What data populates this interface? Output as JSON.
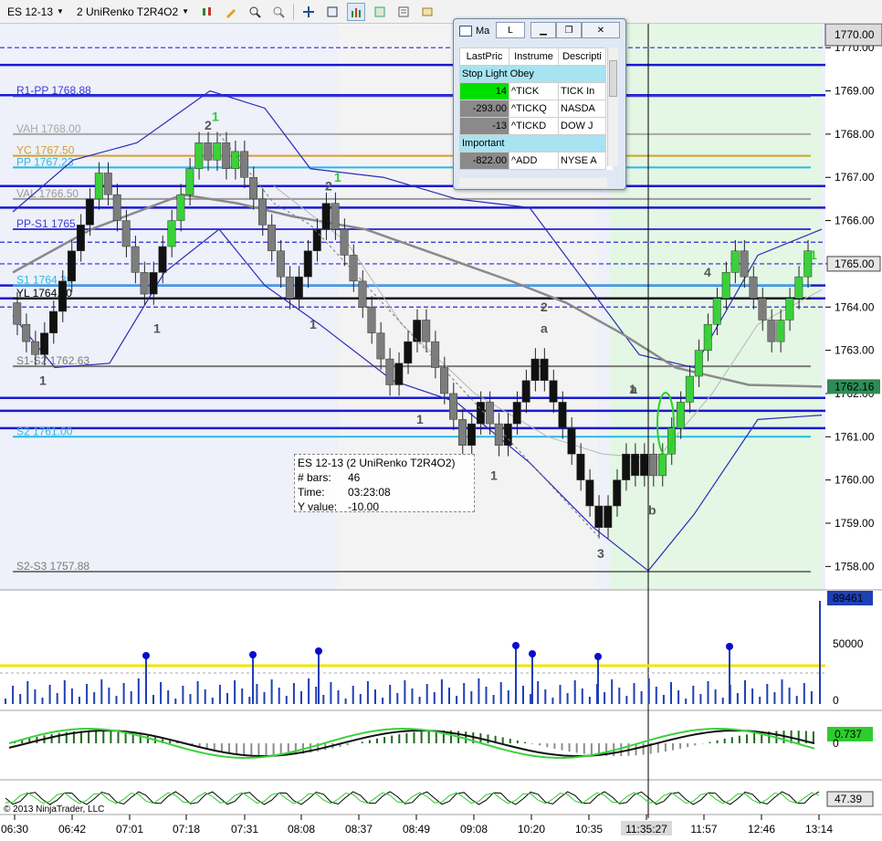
{
  "toolbar": {
    "instrument": "ES 12-13",
    "bar_type": "2 UniRenko T2R4O2"
  },
  "price_axis": {
    "ticks": [
      "1770.00",
      "1769.00",
      "1768.00",
      "1767.00",
      "1766.00",
      "1765.00",
      "1764.00",
      "1763.00",
      "1762.00",
      "1761.00",
      "1760.00",
      "1759.00",
      "1758.00"
    ],
    "current_price": "1765.00",
    "sma_value": "1762.16"
  },
  "levels": [
    {
      "label": "R1-PP 1768.88",
      "value": 1768.88,
      "color": "#3b3bd6"
    },
    {
      "label": "VAH 1768.00",
      "value": 1768.0,
      "color": "#a8a8a8"
    },
    {
      "label": "YC 1767.50",
      "value": 1767.5,
      "color": "#d4a02a"
    },
    {
      "label": "PP 1767.23",
      "value": 1767.23,
      "color": "#28b8e6"
    },
    {
      "label": "VAL 1766.50",
      "value": 1766.5,
      "color": "#9a9a9a"
    },
    {
      "label": "PP-S1 1765",
      "value": 1765.8,
      "color": "#3b3bd6"
    },
    {
      "label": "S1 1764.39",
      "value": 1764.5,
      "color": "#28b8e6"
    },
    {
      "label": "YL 1764.00",
      "value": 1764.2,
      "color": "#000000"
    },
    {
      "label": "S1-S2 1762.63",
      "value": 1762.63,
      "color": "#7a7a7a"
    },
    {
      "label": "S2 1761.00",
      "value": 1761.0,
      "color": "#28b8e6"
    },
    {
      "label": "S2-S3 1757.88",
      "value": 1757.88,
      "color": "#7a7a7a"
    }
  ],
  "wave_labels": [
    "2",
    "1",
    "1",
    "1",
    "2",
    "1",
    "1",
    "1",
    "1",
    "2",
    "a",
    "1",
    "a",
    "3",
    "b",
    "4",
    "1"
  ],
  "data_box": {
    "title": "ES 12-13 (2 UniRenko T2R4O2)",
    "bars_label": "# bars:",
    "bars_value": "46",
    "time_label": "Time:",
    "time_value": "03:23:08",
    "y_label": "Y value:",
    "y_value": "-10.00"
  },
  "market_analyzer": {
    "title": "Ma",
    "button_l": "L",
    "headers": [
      "LastPric",
      "Instrume",
      "Descripti"
    ],
    "section1": "Stop Light Obey",
    "rows1": [
      {
        "last": "14",
        "instrument": "^TICK",
        "desc": "TICK In"
      },
      {
        "last": "-293.00",
        "instrument": "^TICKQ",
        "desc": "NASDA"
      },
      {
        "last": "-13",
        "instrument": "^TICKD",
        "desc": "DOW J"
      }
    ],
    "section2": "Important",
    "rows2": [
      {
        "last": "-822.00",
        "instrument": "^ADD",
        "desc": "NYSE A"
      }
    ]
  },
  "volume_panel": {
    "max_label": "89461",
    "tick_50000": "50000",
    "tick_0": "0"
  },
  "macd_panel": {
    "value": "0.737",
    "tick_0": "0"
  },
  "osc_panel": {
    "value": "47.39"
  },
  "time_axis": {
    "ticks": [
      "06:30",
      "06:42",
      "07:01",
      "07:18",
      "07:31",
      "08:08",
      "08:37",
      "08:49",
      "09:08",
      "10:20",
      "10:35",
      "11:35:27",
      "11:57",
      "12:46",
      "13:14"
    ],
    "crosshair_time": "11:35:27"
  },
  "copyright": "© 2013 NinjaTrader, LLC",
  "chart_data": {
    "type": "candlestick-renko",
    "instrument": "ES 12-13",
    "y_range": [
      1757.5,
      1770.3
    ],
    "series": [
      {
        "name": "close",
        "values": [
          1763.6,
          1763.2,
          1762.9,
          1763.4,
          1763.9,
          1764.6,
          1765.3,
          1765.9,
          1766.5,
          1767.1,
          1766.6,
          1766.0,
          1765.4,
          1764.8,
          1764.3,
          1764.8,
          1765.4,
          1766.0,
          1766.6,
          1767.2,
          1767.8,
          1767.4,
          1767.8,
          1767.2,
          1767.6,
          1767.0,
          1766.5,
          1765.9,
          1765.3,
          1764.7,
          1764.2,
          1764.7,
          1765.3,
          1765.8,
          1766.4,
          1765.8,
          1765.2,
          1764.6,
          1764.0,
          1763.4,
          1762.8,
          1762.2,
          1762.7,
          1763.2,
          1763.7,
          1763.2,
          1762.6,
          1762.0,
          1761.4,
          1760.8,
          1761.3,
          1761.8,
          1761.3,
          1760.8,
          1761.3,
          1761.8,
          1762.3,
          1762.8,
          1762.3,
          1761.8,
          1761.2,
          1760.6,
          1760.0,
          1759.4,
          1758.9,
          1759.4,
          1760.0,
          1760.6,
          1760.1,
          1760.6,
          1760.1,
          1760.6,
          1761.2,
          1761.8,
          1762.4,
          1763.0,
          1763.6,
          1764.2,
          1764.8,
          1765.3,
          1764.7,
          1764.2,
          1763.7,
          1763.2,
          1763.7,
          1764.2,
          1764.7,
          1765.3
        ]
      }
    ],
    "volume_max": 89461,
    "macd_last": 0.737,
    "oscillator_last": 47.39
  }
}
